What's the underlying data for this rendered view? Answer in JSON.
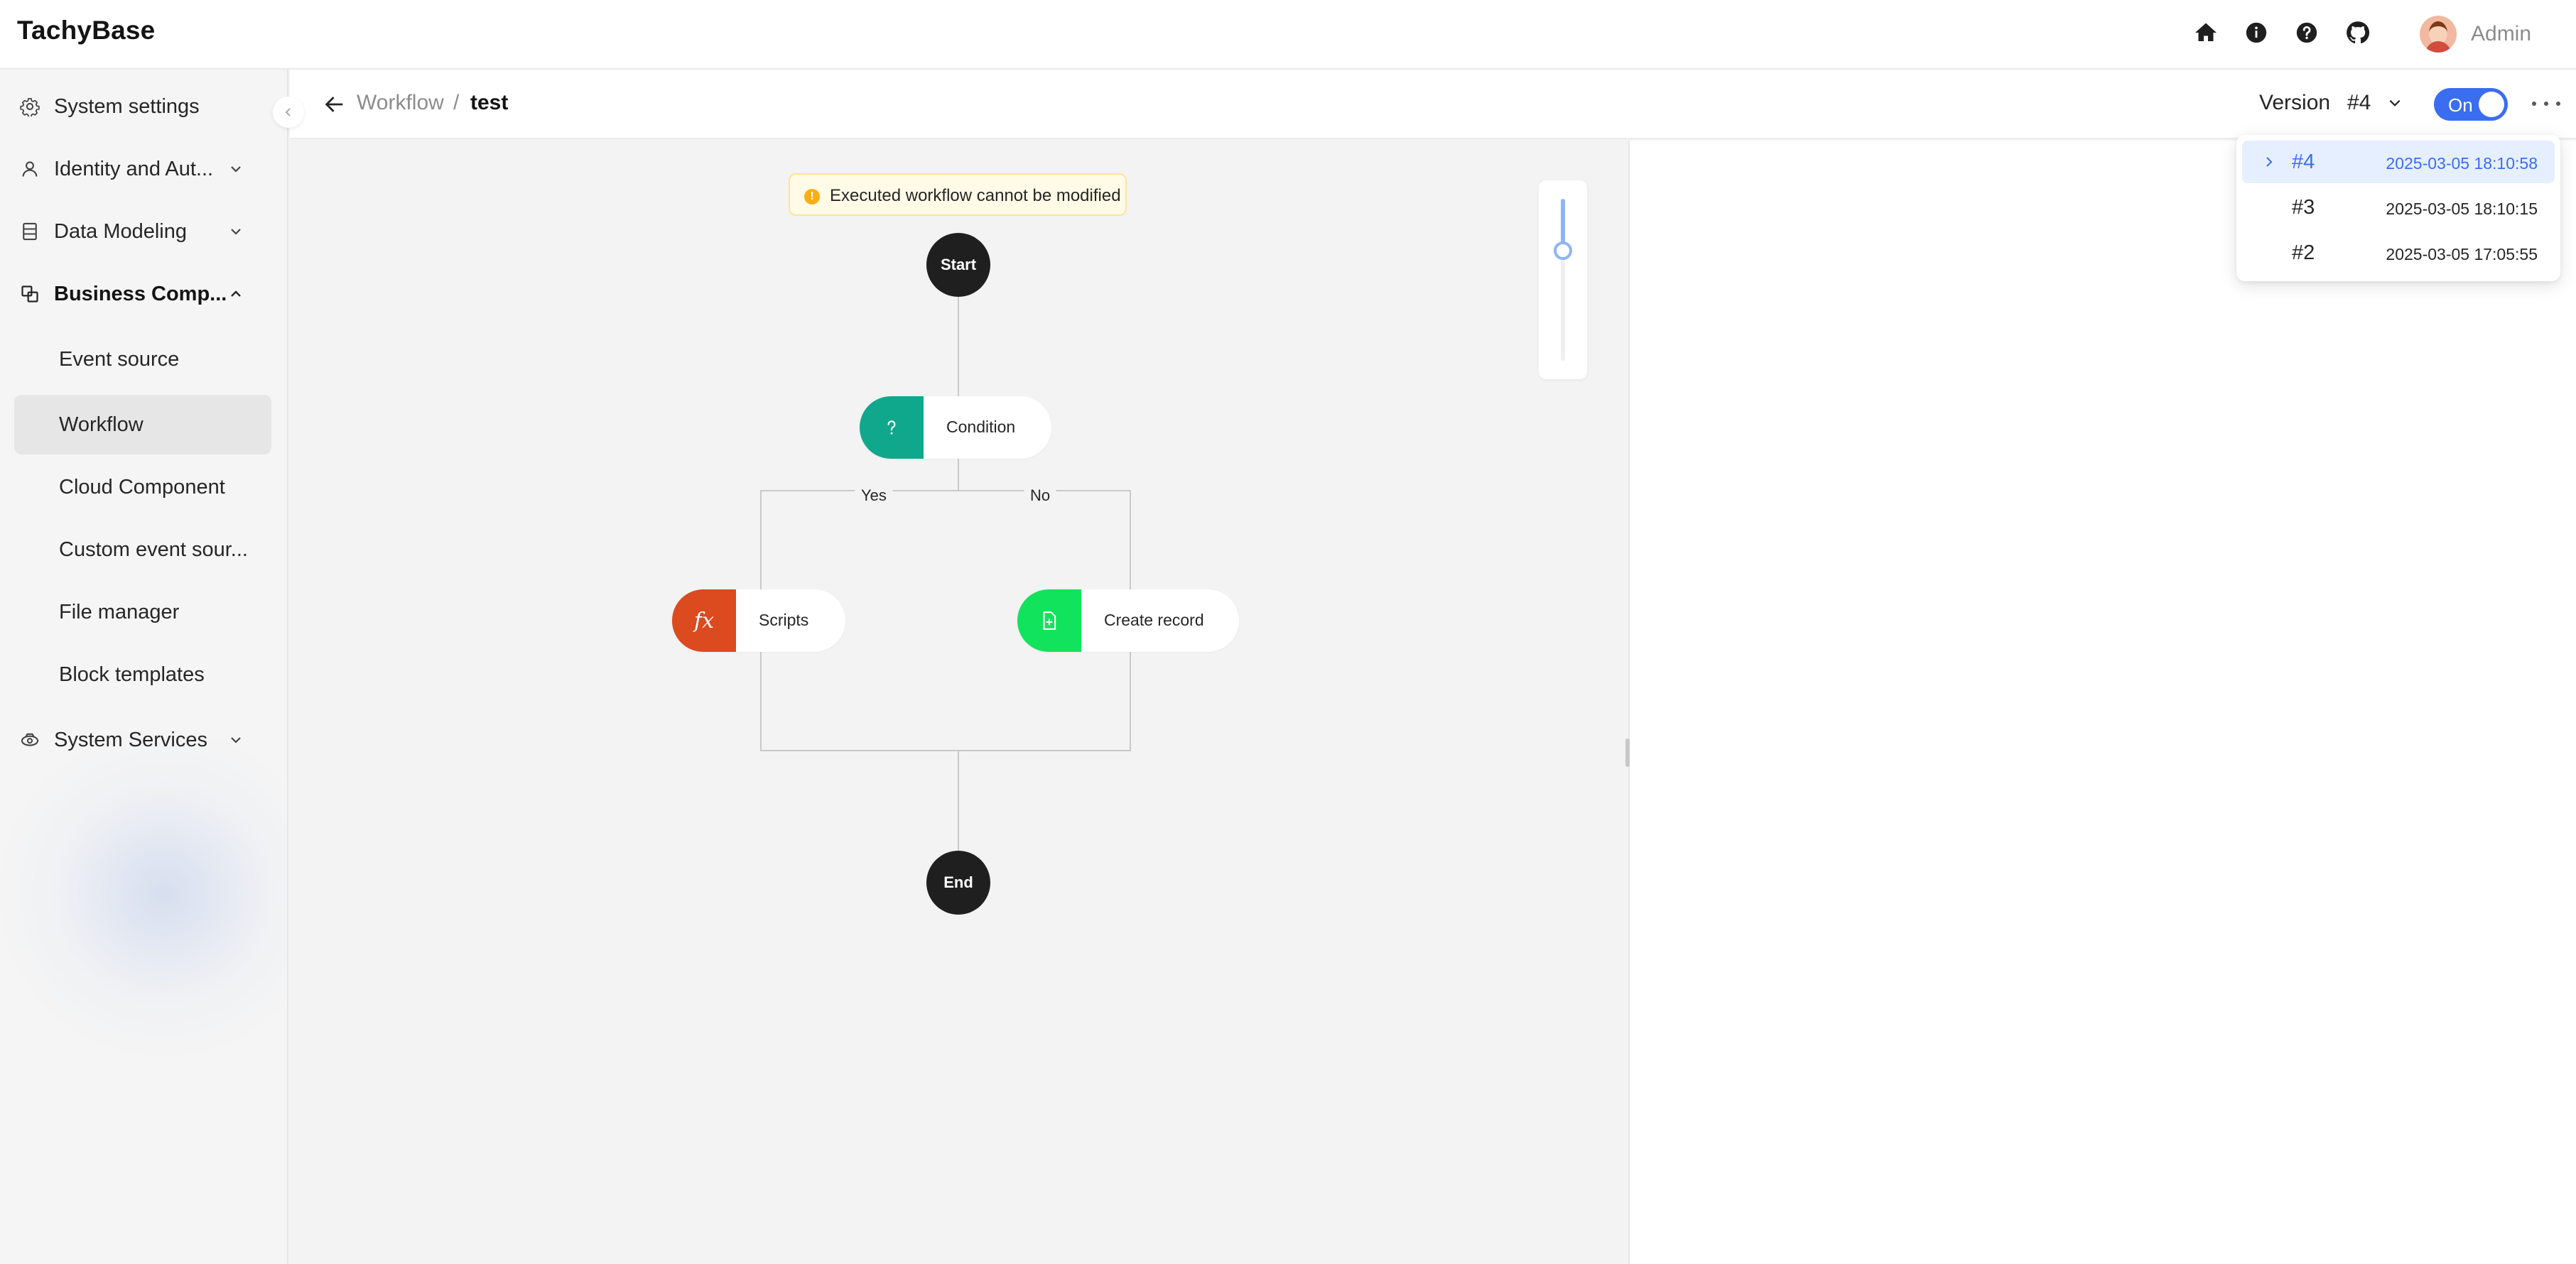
{
  "app": {
    "brand": "TachyBase",
    "user_name": "Admin"
  },
  "header_icons": [
    "home-icon",
    "info-icon",
    "help-icon",
    "github-icon"
  ],
  "sidebar": {
    "items": [
      {
        "label": "System settings",
        "icon": "gear-icon"
      },
      {
        "label": "Identity and Aut...",
        "icon": "user-icon"
      },
      {
        "label": "Data Modeling",
        "icon": "database-icon"
      },
      {
        "label": "Business Comp...",
        "icon": "component-icon"
      },
      {
        "label": "System Services",
        "icon": "services-icon"
      }
    ],
    "sub_items": [
      {
        "label": "Event source"
      },
      {
        "label": "Workflow"
      },
      {
        "label": "Cloud Component"
      },
      {
        "label": "Custom event sour..."
      },
      {
        "label": "File manager"
      },
      {
        "label": "Block templates"
      }
    ]
  },
  "breadcrumb": {
    "parent": "Workflow",
    "separator": "/",
    "current": "test"
  },
  "version": {
    "label": "Version",
    "current": "#4"
  },
  "toggle": {
    "label": "On",
    "state": true
  },
  "notice": {
    "text": "Executed workflow cannot be modified"
  },
  "flow": {
    "start": "Start",
    "end": "End",
    "condition": {
      "title": "Condition",
      "icon": "question-icon",
      "color": "#0fa88c"
    },
    "branch_yes": "Yes",
    "branch_no": "No",
    "scripts": {
      "title": "Scripts",
      "icon": "fx-icon",
      "color": "#dc4a1f"
    },
    "create_record": {
      "title": "Create record",
      "icon": "file-add-icon",
      "color": "#12e35c"
    }
  },
  "zoom": {
    "level": 0.32
  },
  "version_dropdown": [
    {
      "version": "#4",
      "date": "2025-03-05 18:10:58",
      "selected": true
    },
    {
      "version": "#3",
      "date": "2025-03-05 18:10:15",
      "selected": false
    },
    {
      "version": "#2",
      "date": "2025-03-05 17:05:55",
      "selected": false
    }
  ],
  "colors": {
    "accent": "#3a6df0",
    "dark_node": "#1f1f1f",
    "notice_bg": "#fffbe6"
  }
}
